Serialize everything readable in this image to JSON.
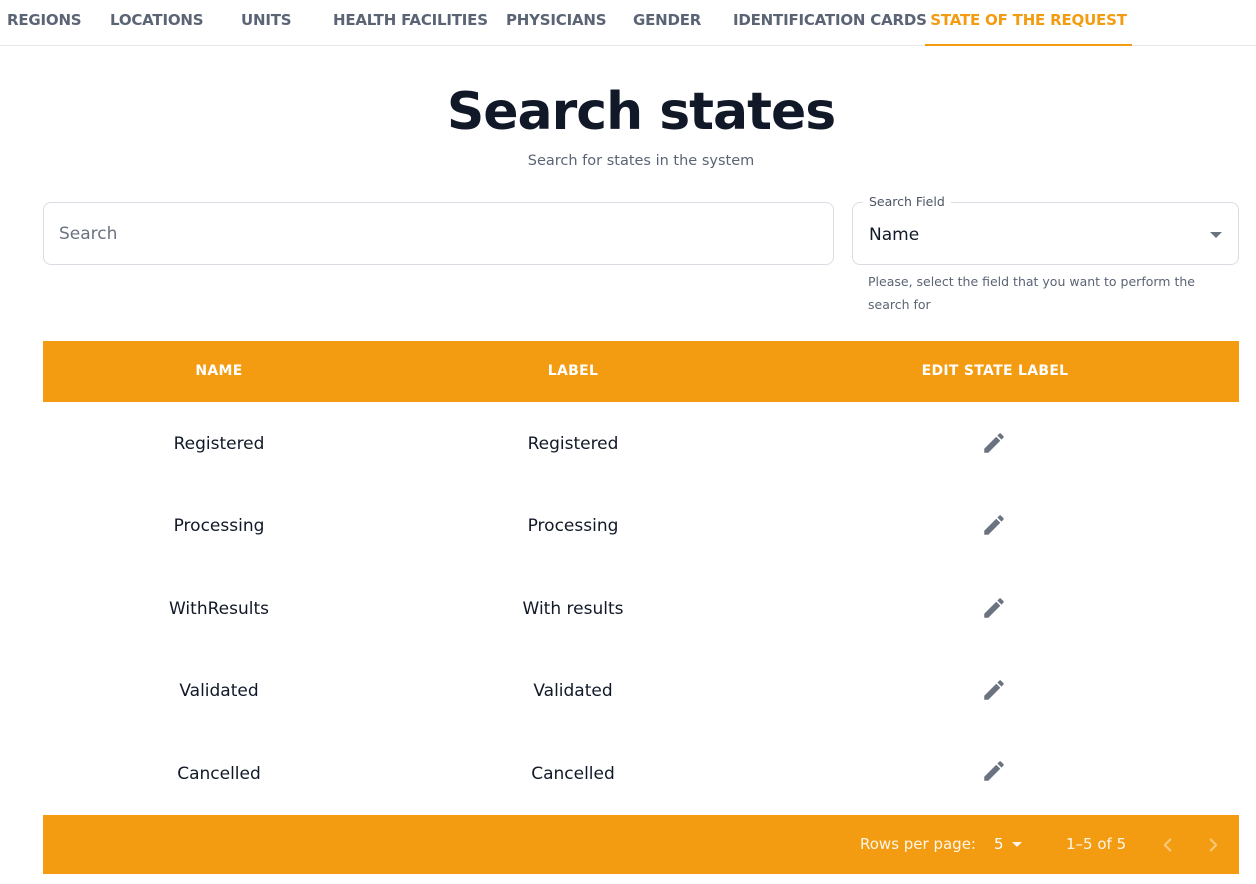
{
  "tabs": [
    {
      "label": "REGIONS",
      "active": false
    },
    {
      "label": "LOCATIONS",
      "active": false
    },
    {
      "label": "UNITS",
      "active": false
    },
    {
      "label": "HEALTH FACILITIES",
      "active": false
    },
    {
      "label": "PHYSICIANS",
      "active": false
    },
    {
      "label": "GENDER",
      "active": false
    },
    {
      "label": "IDENTIFICATION CARDS",
      "active": false
    },
    {
      "label": "STATE OF THE REQUEST",
      "active": true
    }
  ],
  "header": {
    "title": "Search states",
    "subtitle": "Search for states in the system"
  },
  "search": {
    "placeholder": "Search",
    "value": ""
  },
  "search_field": {
    "legend": "Search Field",
    "selected": "Name",
    "help": "Please, select the field that you want to perform the search for"
  },
  "table": {
    "columns": [
      "NAME",
      "LABEL",
      "EDIT STATE LABEL"
    ],
    "rows": [
      {
        "name": "Registered",
        "label": "Registered"
      },
      {
        "name": "Processing",
        "label": "Processing"
      },
      {
        "name": "WithResults",
        "label": "With results"
      },
      {
        "name": "Validated",
        "label": "Validated"
      },
      {
        "name": "Cancelled",
        "label": "Cancelled"
      }
    ],
    "edit_icon": "pencil-icon"
  },
  "pagination": {
    "rows_per_page_label": "Rows per page:",
    "rows_per_page": "5",
    "range": "1–5 of 5"
  },
  "colors": {
    "accent": "#f39c12",
    "tab_text": "#5b6475",
    "icon": "#6b7280"
  }
}
